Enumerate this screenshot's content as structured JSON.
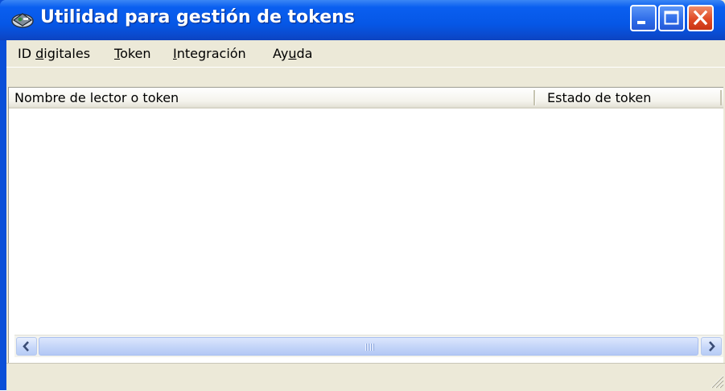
{
  "window": {
    "title": "Utilidad para gestión de tokens",
    "icon": "token-app-icon",
    "controls": [
      "minimize-icon",
      "maximize-icon",
      "close-icon"
    ]
  },
  "menu": {
    "items": [
      {
        "pre": "ID ",
        "key": "d",
        "post": "igitales"
      },
      {
        "pre": "",
        "key": "T",
        "post": "oken"
      },
      {
        "pre": "",
        "key": "I",
        "post": "ntegración"
      },
      {
        "pre": "Ay",
        "key": "u",
        "post": "da"
      }
    ]
  },
  "list": {
    "columns": [
      "Nombre de lector o token",
      "Estado de token"
    ],
    "rows": []
  },
  "colors": {
    "titlebar": "#0657e6",
    "close_button": "#e04a25",
    "face": "#ece9d8"
  }
}
